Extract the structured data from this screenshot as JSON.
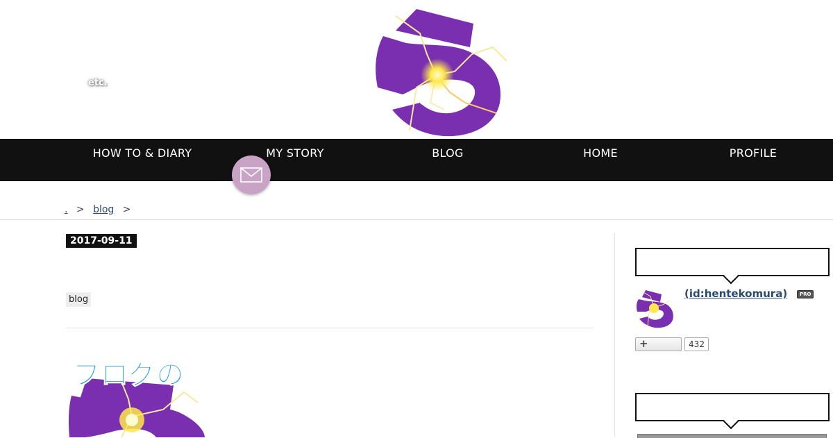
{
  "header": {
    "tagline": "etc.",
    "logo_icon": "bolt-5-logo"
  },
  "nav": {
    "items": [
      {
        "label": "HOW TO & DIARY"
      },
      {
        "label": "MY STORY"
      },
      {
        "label": "BLOG"
      },
      {
        "label": "HOME"
      },
      {
        "label": "PROFILE"
      }
    ]
  },
  "mail_button": {
    "icon": "mail-icon",
    "color": "#c8a3c6"
  },
  "breadcrumb": {
    "home": ".",
    "separator": ">",
    "category": "blog"
  },
  "article": {
    "date": "2017-09-11",
    "category": "blog",
    "eyecatch_text": "ブログの"
  },
  "sidebar": {
    "profile": {
      "id_label": " (id:hentekomura)",
      "badge": "PRO",
      "follow_icon": "plus-icon",
      "follow_count": "432"
    }
  },
  "colors": {
    "nav_bg": "#111111",
    "logo_purple": "#7a2fb0",
    "link": "#2c4a6a",
    "eyecatch_text": "#1e9be0"
  }
}
